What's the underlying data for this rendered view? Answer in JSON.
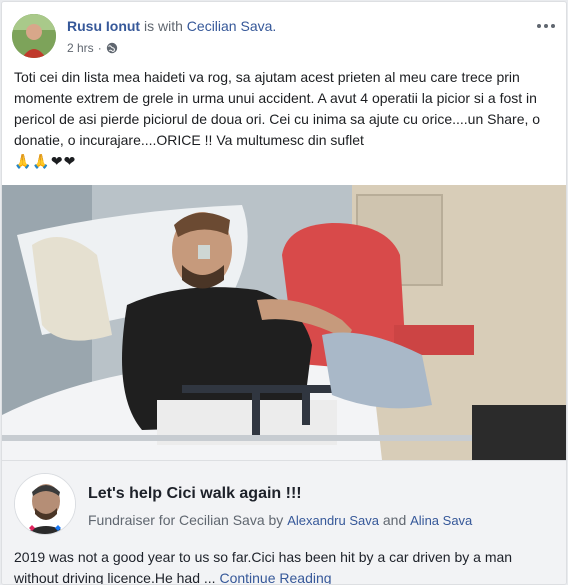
{
  "post": {
    "author": "Rusu Ionut",
    "with_text": " is with ",
    "tagged": "Cecilian Sava.",
    "time": "2 hrs",
    "separator": "·",
    "privacy_icon": "globe-icon",
    "body": "Toti cei din lista mea haideti va rog, sa ajutam acest prieten al meu care trece prin momente extrem de grele in urma unui accident. A avut 4 operatii la picior si a fost in pericol de asi pierde piciorul de doua ori. Cei cu inima sa ajute cu orice....un Share, o donatie, o incurajare....ORICE !! Va multumesc din suflet",
    "emojis": "🙏🙏❤❤"
  },
  "fundraiser": {
    "title": "Let's help Cici walk again !!!",
    "subtitle_prefix": "Fundraiser for Cecilian Sava by ",
    "organizer1": "Alexandru Sava",
    "and": " and ",
    "organizer2": "Alina Sava",
    "description": "2019 was not a good year to us so far.Cici has been hit by a car driven by a man without driving licence.He had ... ",
    "continue_label": "Continue Reading"
  },
  "colors": {
    "link": "#365899",
    "secondary_text": "#606770",
    "heart": "#e0245e"
  }
}
